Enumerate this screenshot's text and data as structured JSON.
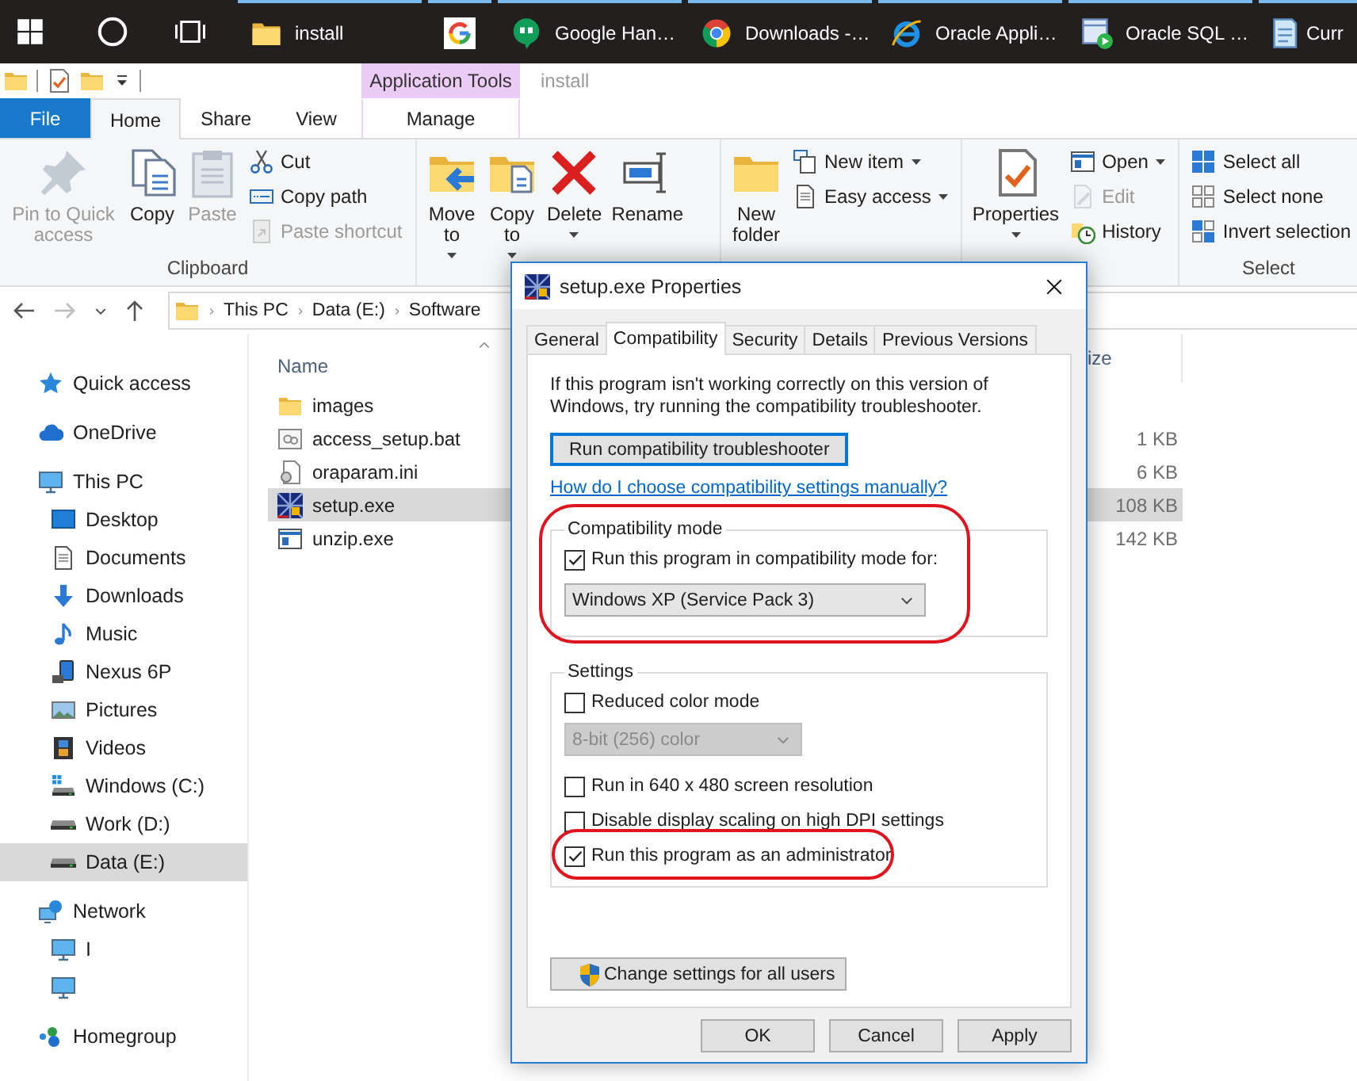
{
  "taskbar": {
    "apps": [
      {
        "label": "install",
        "running": true
      },
      {
        "running": true
      },
      {
        "label": "Google Han…",
        "running": true
      },
      {
        "label": "Downloads -…",
        "running": true
      },
      {
        "label": "Oracle Appli…",
        "running": true
      },
      {
        "label": "Oracle SQL …",
        "running": true
      },
      {
        "label": "Curr",
        "running": true
      }
    ]
  },
  "ribbon": {
    "context_tab": "Application Tools",
    "title": "install",
    "tabs": [
      {
        "label": "File",
        "kind": "file",
        "selected": false
      },
      {
        "label": "Home",
        "kind": "plain",
        "selected": true
      },
      {
        "label": "Share",
        "kind": "plain",
        "selected": false
      },
      {
        "label": "View",
        "kind": "plain",
        "selected": false
      },
      {
        "label": "Manage",
        "kind": "context",
        "selected": false
      }
    ],
    "groups": [
      {
        "label": "Clipboard",
        "large": [
          {
            "label": "Pin to Quick access",
            "disabled": true,
            "menu": false
          },
          {
            "label": "Copy",
            "disabled": false,
            "menu": false
          },
          {
            "label": "Paste",
            "disabled": true,
            "menu": false
          }
        ],
        "small": [
          {
            "label": "Cut",
            "disabled": false,
            "menu": false
          },
          {
            "label": "Copy path",
            "disabled": false,
            "menu": false
          },
          {
            "label": "Paste shortcut",
            "disabled": true,
            "menu": false
          }
        ]
      },
      {
        "large": [
          {
            "label": "Move to",
            "disabled": false,
            "menu": true
          },
          {
            "label": "Copy to",
            "disabled": false,
            "menu": true
          },
          {
            "label": "Delete",
            "disabled": false,
            "menu": true
          },
          {
            "label": "Rename",
            "disabled": false,
            "menu": false
          }
        ]
      },
      {
        "large": [
          {
            "label": "New folder",
            "disabled": false,
            "menu": false
          }
        ],
        "small": [
          {
            "label": "New item",
            "disabled": false,
            "menu": true
          },
          {
            "label": "Easy access",
            "disabled": false,
            "menu": true
          }
        ]
      },
      {
        "large": [
          {
            "label": "Properties",
            "disabled": false,
            "menu": true
          }
        ],
        "small": [
          {
            "label": "Open",
            "disabled": false,
            "menu": true
          },
          {
            "label": "Edit",
            "disabled": true,
            "menu": false
          },
          {
            "label": "History",
            "disabled": false,
            "menu": false
          }
        ]
      },
      {
        "label": "Select",
        "small": [
          {
            "label": "Select all",
            "disabled": false,
            "menu": false
          },
          {
            "label": "Select none",
            "disabled": false,
            "menu": false
          },
          {
            "label": "Invert selection",
            "disabled": false,
            "menu": false
          }
        ]
      }
    ]
  },
  "address": {
    "path": [
      "This PC",
      "Data (E:)",
      "Software"
    ]
  },
  "navigation": [
    {
      "label": "Quick access",
      "selected": false
    },
    {
      "label": "OneDrive",
      "selected": false
    },
    {
      "label": "This PC",
      "selected": false,
      "children": [
        {
          "label": "Desktop",
          "selected": false
        },
        {
          "label": "Documents",
          "selected": false
        },
        {
          "label": "Downloads",
          "selected": false
        },
        {
          "label": "Music",
          "selected": false
        },
        {
          "label": "Nexus 6P",
          "selected": false
        },
        {
          "label": "Pictures",
          "selected": false
        },
        {
          "label": "Videos",
          "selected": false
        },
        {
          "label": "Windows (C:)",
          "selected": false
        },
        {
          "label": "Work (D:)",
          "selected": false
        },
        {
          "label": "Data (E:)",
          "selected": true
        }
      ]
    },
    {
      "label": "Network",
      "selected": false,
      "children": [
        {
          "label": "I",
          "selected": false
        },
        {
          "selected": false
        }
      ]
    },
    {
      "label": "Homegroup",
      "selected": false
    }
  ],
  "files": {
    "columns": [
      {
        "label": "Name"
      },
      {
        "label": "ize"
      }
    ],
    "rows": [
      {
        "name": "images",
        "selected": false
      },
      {
        "name": "access_setup.bat",
        "size": "1 KB",
        "selected": false
      },
      {
        "name": "oraparam.ini",
        "size": "6 KB",
        "selected": false
      },
      {
        "name": "setup.exe",
        "size": "108 KB",
        "selected": true
      },
      {
        "name": "unzip.exe",
        "size": "142 KB",
        "selected": false
      }
    ]
  },
  "dialog": {
    "title": "setup.exe Properties",
    "tabs": [
      {
        "label": "General",
        "selected": false
      },
      {
        "label": "Compatibility",
        "selected": true
      },
      {
        "label": "Security",
        "selected": false
      },
      {
        "label": "Details",
        "selected": false
      },
      {
        "label": "Previous Versions",
        "selected": false
      }
    ],
    "intro": "If this program isn't working correctly on this version of Windows, try running the compatibility troubleshooter.",
    "troubleshoot_button": "Run compatibility troubleshooter",
    "help_link": "How do I choose compatibility settings manually?",
    "groups": [
      {
        "legend": "Compatibility mode",
        "annotated": true,
        "controls": [
          {
            "kind": "checkbox",
            "label": "Run this program in compatibility mode for:",
            "checked": true,
            "annotated": false
          },
          {
            "kind": "dropdown",
            "value": "Windows XP (Service Pack 3)",
            "disabled": false,
            "annotated": false
          }
        ]
      },
      {
        "legend": "Settings",
        "annotated": false,
        "controls": [
          {
            "kind": "checkbox",
            "label": "Reduced color mode",
            "checked": false,
            "annotated": false
          },
          {
            "kind": "dropdown",
            "value": "8-bit (256) color",
            "disabled": true,
            "annotated": false
          },
          {
            "kind": "checkbox",
            "label": "Run in 640 x 480 screen resolution",
            "checked": false,
            "annotated": false
          },
          {
            "kind": "checkbox",
            "label": "Disable display scaling on high DPI settings",
            "checked": false,
            "annotated": false
          },
          {
            "kind": "checkbox",
            "label": "Run this program as an administrator",
            "checked": true,
            "annotated": true
          }
        ]
      }
    ],
    "all_users_button": "Change settings for all users",
    "buttons": [
      "OK",
      "Cancel",
      "Apply"
    ]
  }
}
